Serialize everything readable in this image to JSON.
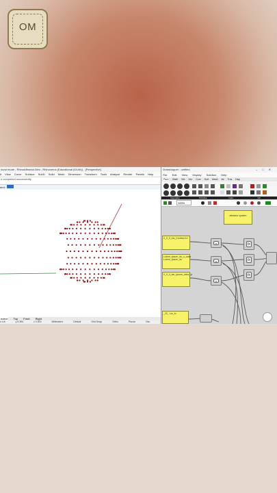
{
  "logo": {
    "text": "OM"
  },
  "rhino": {
    "title": "ound mode - RhinoAttractor.3dm - Rhinoceros (Educational (64-bit)) - [Perspective]",
    "menu": [
      "it",
      "View",
      "Curve",
      "Surface",
      "SubD",
      "Solid",
      "Mesh",
      "Dimension",
      "Transform",
      "Tools",
      "Analyze",
      "Render",
      "Panels",
      "Help"
    ],
    "command_history": "e completed successfully.",
    "prompt_label": "and:",
    "viewport_tabs": [
      "ective",
      "Top",
      "Front",
      "Right"
    ],
    "status": [
      "x 4.8",
      "y 5.354",
      "z 0.000",
      "Millimeters",
      "Default",
      "Grid Snap",
      "Ortho",
      "Planar",
      "Osn"
    ]
  },
  "grasshopper": {
    "title": "Grasshopper - untitled",
    "menu": [
      "File",
      "Edit",
      "View",
      "Display",
      "Solution",
      "Help"
    ],
    "ribbon_tabs": [
      "Para",
      "Math",
      "Set",
      "Vec",
      "Curv",
      "Surf",
      "Mesh",
      "Int",
      "Trns",
      "Disp"
    ],
    "category_labels": [
      "Geometry",
      "Primitive",
      "Input",
      "Util"
    ],
    "zoom": "100%",
    "canvas": {
      "top_panel": "attractor system",
      "panels": [
        "0_0_9_Ins_Control-0.0",
        "Lorem_ipsum_do_x_dolor\nLorem_ipsum_do",
        "0_0_9_lan_Ipsum_dolor_ip",
        "_22_ Lor_lo"
      ],
      "params": [
        "x",
        "y",
        "z"
      ],
      "components": [
        "fx",
        "fx",
        "fx"
      ]
    }
  },
  "colors": {
    "points": "#8b0d0d",
    "x_axis": "#1e9a1e",
    "line": "#a0283c",
    "panel": "#f6f36a"
  }
}
